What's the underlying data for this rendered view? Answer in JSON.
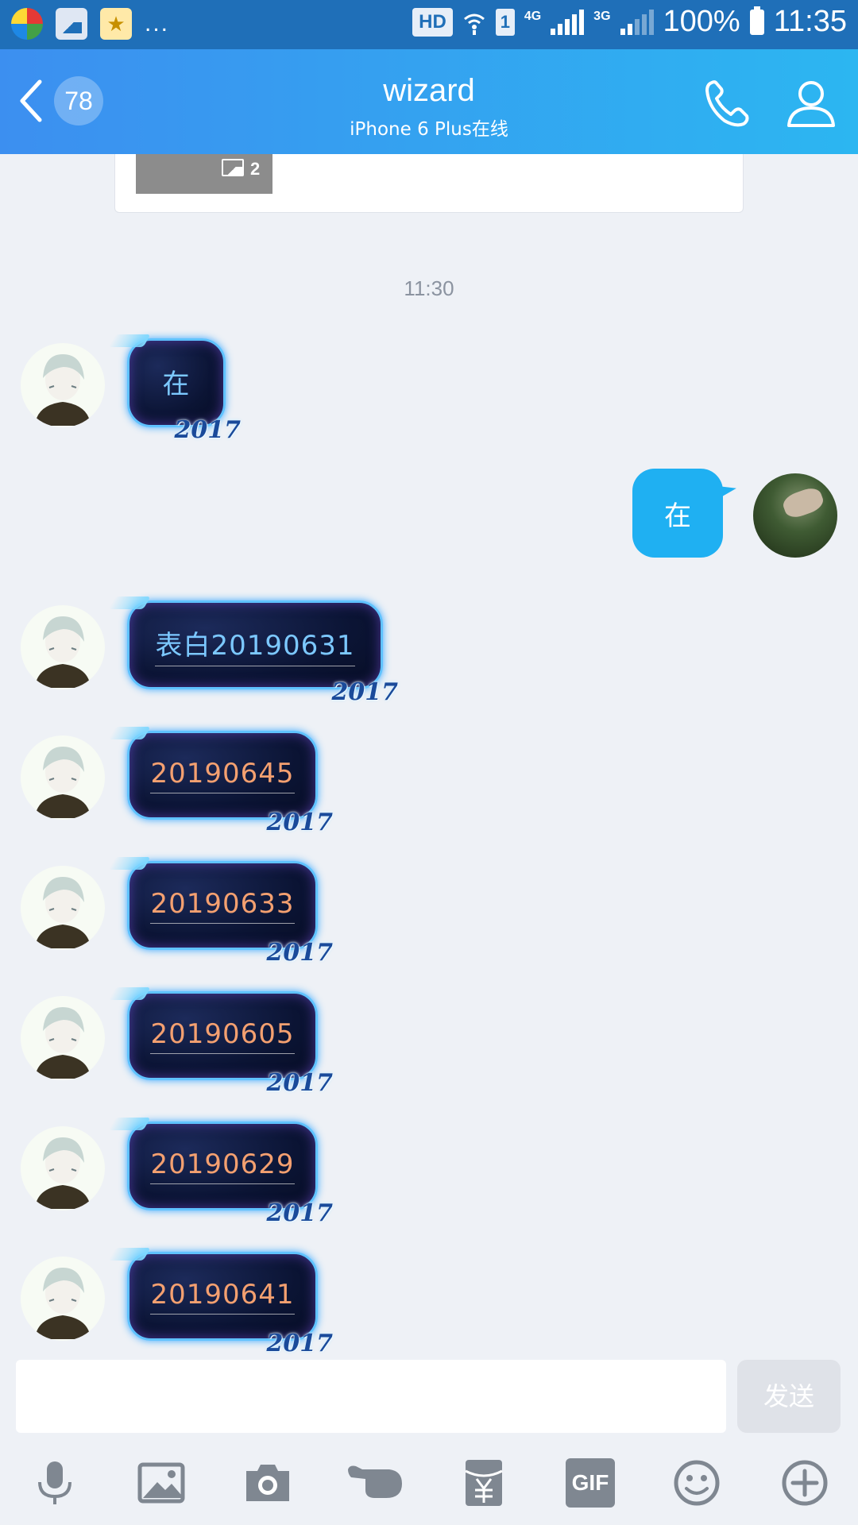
{
  "status_bar": {
    "hd": "HD",
    "sim": "1",
    "net1": "4G",
    "net2": "3G",
    "battery": "100%",
    "time": "11:35"
  },
  "header": {
    "unread_count": "78",
    "title": "wizard",
    "subtitle": "iPhone 6 Plus在线"
  },
  "previous_card": {
    "image_count": "2"
  },
  "timestamp": "11:30",
  "messages": [
    {
      "from": "contact",
      "text": "在"
    },
    {
      "from": "self",
      "text": "在"
    },
    {
      "from": "contact",
      "text": "表白20190631"
    },
    {
      "from": "contact",
      "text": "20190645"
    },
    {
      "from": "contact",
      "text": "20190633"
    },
    {
      "from": "contact",
      "text": "20190605"
    },
    {
      "from": "contact",
      "text": "20190629"
    },
    {
      "from": "contact",
      "text": "20190641"
    }
  ],
  "bubble_badge": "2017",
  "input": {
    "send_label": "发送"
  },
  "toolbar_icons": [
    "microphone-icon",
    "image-icon",
    "camera-icon",
    "poke-icon",
    "red-packet-icon",
    "gif-icon",
    "emoji-icon",
    "plus-icon"
  ],
  "toolbar_gif_label": "GIF",
  "colors": {
    "header_start": "#3c8ff0",
    "header_end": "#2cb6f1",
    "self_bubble": "#1fb0f2",
    "background": "#eef1f6"
  }
}
